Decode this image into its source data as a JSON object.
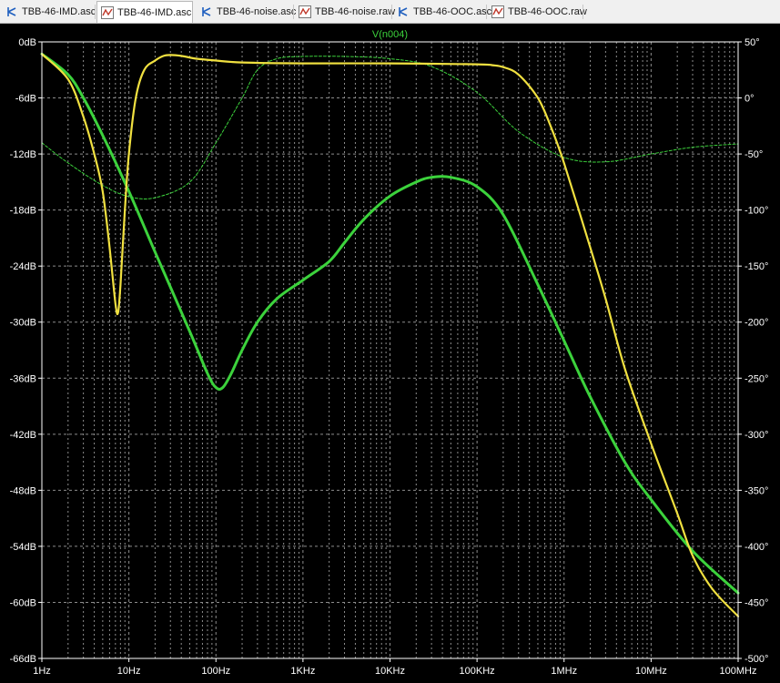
{
  "tabs": [
    {
      "label": "TBB-46-IMD.asc",
      "icon": "schematic-icon",
      "active": false
    },
    {
      "label": "TBB-46-IMD.asc",
      "icon": "waveform-icon",
      "active": true
    },
    {
      "label": "TBB-46-noise.asc",
      "icon": "schematic-icon",
      "active": false
    },
    {
      "label": "TBB-46-noise.raw",
      "icon": "waveform-icon",
      "active": false
    },
    {
      "label": "TBB-46-OOC.asc",
      "icon": "schematic-icon",
      "active": false
    },
    {
      "label": "TBB-46-OOC.raw",
      "icon": "waveform-icon",
      "active": false
    }
  ],
  "colors": {
    "background": "#000000",
    "frame": "#ffffff",
    "grid": "#8c8c8c",
    "trace_label": "#3cd23c",
    "yellow_trace": "#f0e040",
    "green_trace": "#3cd23c",
    "phase_trace": "#3cd23c"
  },
  "chart_data": {
    "type": "line",
    "title": "V(n004)",
    "x_scale": "log",
    "xlim": [
      1,
      100000000
    ],
    "x_ticks": [
      "1Hz",
      "10Hz",
      "100Hz",
      "1KHz",
      "10KHz",
      "100KHz",
      "1MHz",
      "10MHz",
      "100MHz"
    ],
    "ylim_left": [
      -66,
      0
    ],
    "y_ticks_left": [
      "0dB",
      "-6dB",
      "-12dB",
      "-18dB",
      "-24dB",
      "-30dB",
      "-36dB",
      "-42dB",
      "-48dB",
      "-54dB",
      "-60dB",
      "-66dB"
    ],
    "ylim_right": [
      -500,
      50
    ],
    "y_ticks_right": [
      "50°",
      "0°",
      "-50°",
      "-100°",
      "-150°",
      "-200°",
      "-250°",
      "-300°",
      "-350°",
      "-400°",
      "-450°",
      "-500°"
    ],
    "grid": true,
    "series": [
      {
        "style": "solid-yellow",
        "axis": "left",
        "x": [
          1,
          2,
          3,
          4,
          5,
          6,
          7,
          7.5,
          8,
          9,
          10,
          12,
          15,
          20,
          25,
          30,
          40,
          60,
          100,
          200,
          1000,
          10000,
          100000,
          150000,
          200000,
          300000,
          500000,
          700000,
          1000000,
          2000000,
          3000000,
          5000000,
          10000000,
          20000000,
          30000000,
          50000000,
          100000000
        ],
        "y": [
          -1.3,
          -4,
          -8,
          -12,
          -16,
          -22,
          -28,
          -29,
          -26,
          -18,
          -12,
          -6,
          -3,
          -2,
          -1.5,
          -1.4,
          -1.5,
          -1.8,
          -2,
          -2.2,
          -2.3,
          -2.3,
          -2.4,
          -2.5,
          -2.7,
          -3.5,
          -6,
          -9,
          -13,
          -22,
          -27.5,
          -35,
          -43,
          -50.5,
          -55,
          -58.5,
          -61.5
        ]
      },
      {
        "style": "solid-green",
        "axis": "left",
        "x": [
          1,
          2,
          3,
          5,
          10,
          20,
          50,
          80,
          100,
          120,
          150,
          200,
          300,
          500,
          1000,
          2000,
          3000,
          5000,
          10000,
          20000,
          30000,
          50000,
          100000,
          200000,
          500000,
          1000000,
          2000000,
          5000000,
          10000000,
          30000000,
          100000000
        ],
        "y": [
          -1.3,
          -3.5,
          -6,
          -10,
          -16,
          -22.5,
          -31,
          -35.5,
          -37,
          -37,
          -35.5,
          -33,
          -30,
          -27.5,
          -25.5,
          -23.5,
          -21.5,
          -19,
          -16.5,
          -15,
          -14.5,
          -14.5,
          -15.5,
          -18.5,
          -26,
          -32,
          -38,
          -45,
          -49,
          -54.5,
          -59
        ]
      },
      {
        "style": "dashed-green",
        "axis": "right",
        "x": [
          1,
          2,
          5,
          10,
          20,
          50,
          100,
          200,
          300,
          500,
          1000,
          3000,
          10000,
          30000,
          100000,
          300000,
          1000000,
          3000000,
          10000000,
          30000000,
          100000000
        ],
        "y": [
          -40,
          -58,
          -78,
          -88,
          -89,
          -75,
          -40,
          0,
          25,
          35,
          37,
          37,
          35,
          28,
          5,
          -30,
          -53,
          -57,
          -50,
          -44,
          -41
        ]
      }
    ]
  }
}
